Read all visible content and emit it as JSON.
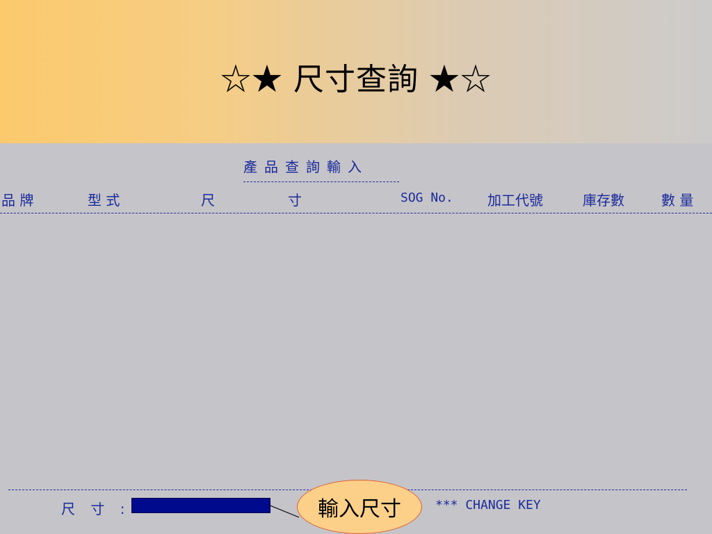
{
  "banner": {
    "title": "☆★ 尺寸查詢 ★☆"
  },
  "form": {
    "title": "產品查詢輸入",
    "columns": [
      "品 牌",
      "型 式",
      "尺",
      "寸",
      "SOG No.",
      "加工代號",
      "庫存數",
      "數 量"
    ],
    "input_label": "尺 寸 :",
    "input_value": "",
    "change_key": "***  CHANGE KEY"
  },
  "callout": {
    "text": "輸入尺寸"
  },
  "colors": {
    "banner_start": "#fcca6c",
    "banner_end": "#cccbcb",
    "screen_bg": "#c5c4c9",
    "text": "#1a2a9a",
    "input": "#000a8c",
    "callout_fill": "#fdd08a"
  }
}
